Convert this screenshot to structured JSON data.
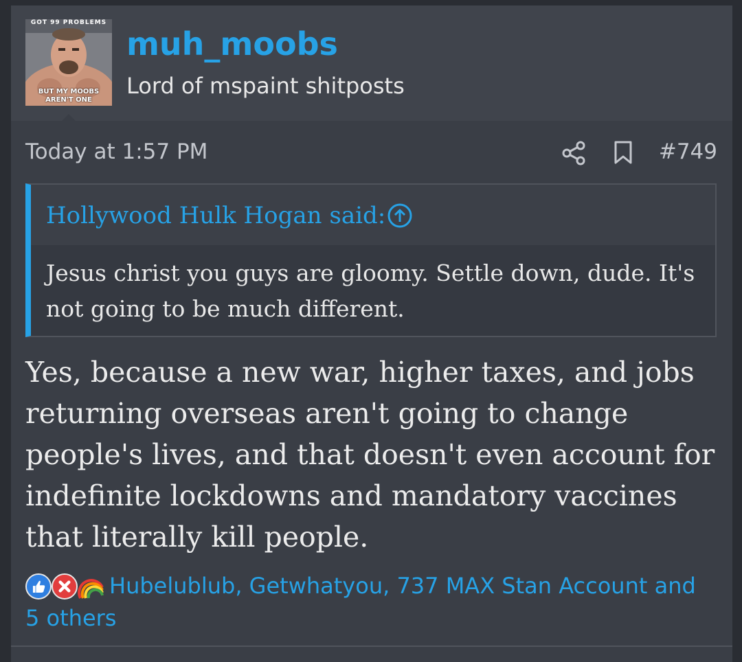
{
  "post": {
    "author": {
      "username": "muh_moobs",
      "title": "Lord of mspaint shitposts",
      "avatar_caption_top": "GOT 99 PROBLEMS",
      "avatar_caption_bottom": "BUT MY MOOBS AREN'T ONE"
    },
    "timestamp": "Today at 1:57 PM",
    "post_number": "#749",
    "icons": {
      "share": "share-icon",
      "bookmark": "bookmark-icon",
      "jump_to_quote": "arrow-up-circle-icon"
    },
    "quote": {
      "author_label": "Hollywood Hulk Hogan said:",
      "body": "Jesus christ you guys are gloomy. Settle down, dude. It's not going to be much different."
    },
    "message": "Yes, because a new war, higher taxes, and jobs returning overseas aren't going to change people's lives, and that doesn't even account for indefinite lockdowns and mandatory vaccines that literally kill people.",
    "reactions": {
      "icons": [
        "like-icon",
        "dislike-x-icon",
        "rainbow-icon"
      ],
      "summary": "Hubelublub, Getwhatyou, 737 MAX Stan Account and 5 others"
    },
    "colors": {
      "accent": "#27a2e6",
      "post_bg": "#3a3e46",
      "header_bg": "#40444c",
      "page_bg": "#2a2d33",
      "text": "#e8e8e8",
      "muted": "#c4c7cd"
    }
  }
}
